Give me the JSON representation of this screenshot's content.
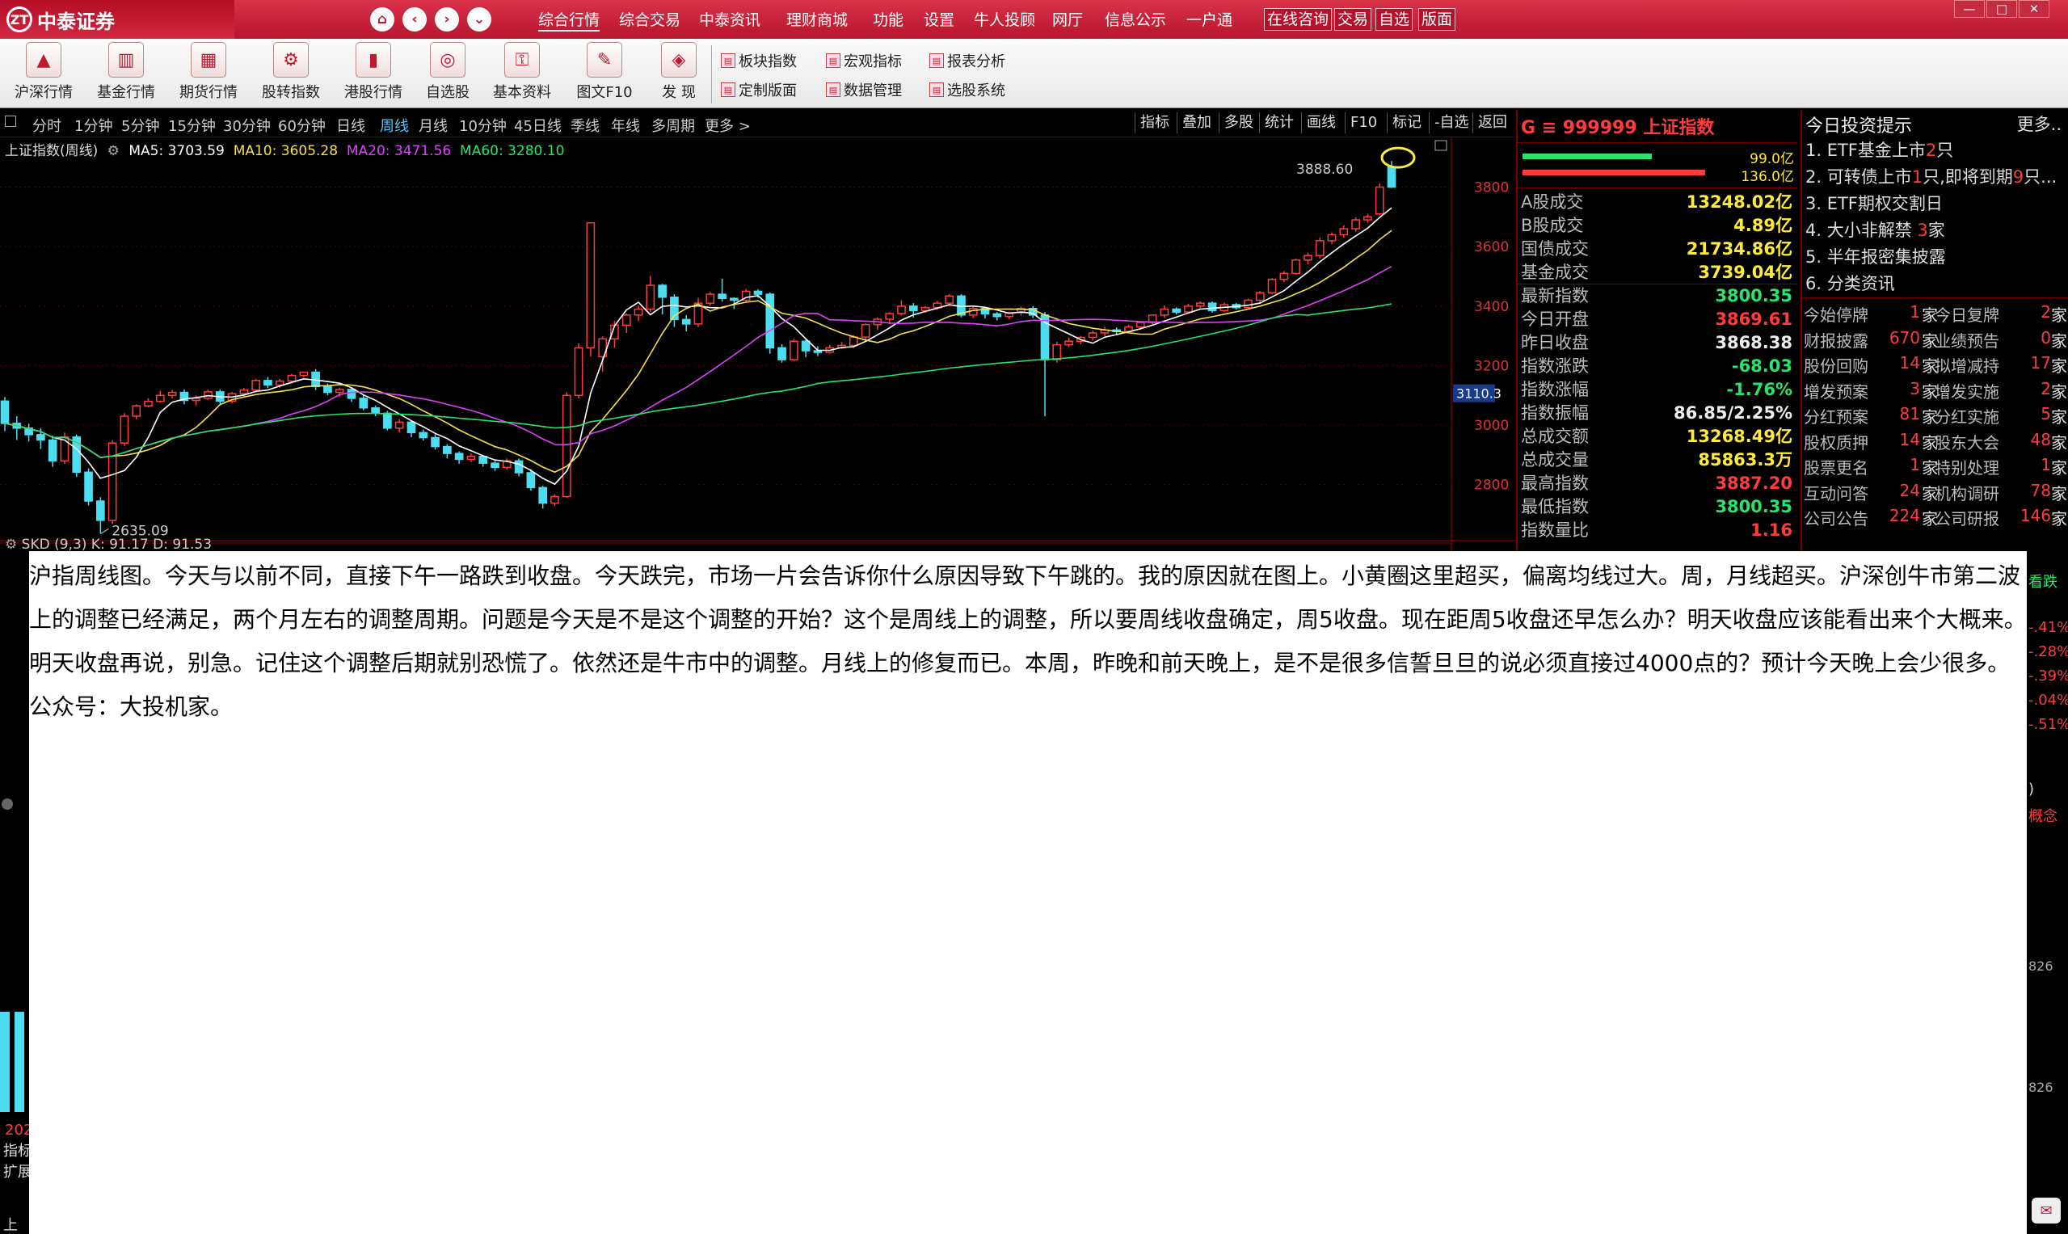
{
  "app": {
    "logo_text": "中泰证券",
    "logo_mark": "ZT",
    "nav_icons": [
      "home-icon",
      "back-icon",
      "forward-icon",
      "dropdown-icon"
    ],
    "menu": [
      "综合行情",
      "综合交易",
      "中泰资讯",
      "理财商城",
      "功能",
      "设置",
      "牛人投顾",
      "网厅",
      "信息公示",
      "一户通"
    ],
    "boxed_menu": [
      "在线咨询",
      "交易",
      "自选",
      "版面"
    ],
    "window_buttons": [
      "—",
      "□",
      "✕"
    ]
  },
  "toolbar": {
    "big_buttons": [
      "沪深行情",
      "基金行情",
      "期货行情",
      "股转指数",
      "港股行情",
      "自选股",
      "基本资料",
      "图文F10",
      "发 现"
    ],
    "small_buttons": [
      [
        "板块指数",
        "宏观指标",
        "报表分析"
      ],
      [
        "定制版面",
        "数据管理",
        "选股系统"
      ]
    ]
  },
  "periodbar": {
    "periods": [
      "分时",
      "1分钟",
      "5分钟",
      "15分钟",
      "30分钟",
      "60分钟",
      "日线",
      "周线",
      "月线",
      "10分钟",
      "45日线",
      "季线",
      "年线",
      "多周期",
      "更多 >"
    ],
    "active": "周线",
    "tools": [
      "指标",
      "叠加",
      "多股",
      "统计",
      "画线",
      "F10",
      "标记",
      "-自选",
      "返回"
    ]
  },
  "chart": {
    "title": "上证指数(周线)",
    "ma": [
      {
        "label": "MA5: 3703.59",
        "color": "#ffffff"
      },
      {
        "label": "MA10: 3605.28",
        "color": "#f4e04d"
      },
      {
        "label": "MA20: 3471.56",
        "color": "#e040fb"
      },
      {
        "label": "MA60: 3280.10",
        "color": "#29e36a"
      }
    ],
    "yticks": [
      "3800",
      "3600",
      "3400",
      "3200",
      "3000",
      "2800"
    ],
    "high_label": "3888.60",
    "low_label": "2635.09",
    "current_tag": "3110.3",
    "sub_indicator": "SKD (9,3) K: 91.17  D: 91.53"
  },
  "chart_data": {
    "type": "candlestick",
    "ylim": [
      2620,
      3940
    ],
    "candles": [
      [
        3081,
        3006,
        3095,
        2980
      ],
      [
        3006,
        2990,
        3030,
        2950
      ],
      [
        2990,
        2968,
        3005,
        2945
      ],
      [
        2968,
        2950,
        2990,
        2920
      ],
      [
        2950,
        2880,
        2965,
        2860
      ],
      [
        2880,
        2960,
        2975,
        2870
      ],
      [
        2960,
        2842,
        2968,
        2826
      ],
      [
        2842,
        2745,
        2855,
        2730
      ],
      [
        2745,
        2680,
        2758,
        2635
      ],
      [
        2680,
        2940,
        2950,
        2668
      ],
      [
        2940,
        3030,
        3040,
        2930
      ],
      [
        3030,
        3065,
        3070,
        3020
      ],
      [
        3065,
        3080,
        3090,
        3060
      ],
      [
        3080,
        3100,
        3115,
        3075
      ],
      [
        3100,
        3110,
        3118,
        3090
      ],
      [
        3110,
        3083,
        3120,
        3070
      ],
      [
        3083,
        3090,
        3100,
        3066
      ],
      [
        3090,
        3112,
        3120,
        3085
      ],
      [
        3112,
        3081,
        3120,
        3072
      ],
      [
        3081,
        3106,
        3112,
        3073
      ],
      [
        3106,
        3118,
        3125,
        3095
      ],
      [
        3118,
        3150,
        3155,
        3110
      ],
      [
        3150,
        3135,
        3162,
        3125
      ],
      [
        3135,
        3148,
        3155,
        3126
      ],
      [
        3148,
        3167,
        3172,
        3140
      ],
      [
        3167,
        3178,
        3180,
        3160
      ],
      [
        3178,
        3130,
        3188,
        3118
      ],
      [
        3130,
        3110,
        3140,
        3100
      ],
      [
        3110,
        3120,
        3126,
        3095
      ],
      [
        3120,
        3090,
        3128,
        3078
      ],
      [
        3090,
        3058,
        3100,
        3050
      ],
      [
        3058,
        3040,
        3066,
        3030
      ],
      [
        3040,
        2990,
        3048,
        2982
      ],
      [
        2990,
        3010,
        3020,
        2975
      ],
      [
        3010,
        2975,
        3016,
        2960
      ],
      [
        2975,
        2958,
        2985,
        2948
      ],
      [
        2958,
        2928,
        2970,
        2918
      ],
      [
        2928,
        2905,
        2936,
        2888
      ],
      [
        2905,
        2885,
        2912,
        2870
      ],
      [
        2885,
        2895,
        2905,
        2876
      ],
      [
        2895,
        2872,
        2900,
        2860
      ],
      [
        2872,
        2858,
        2880,
        2846
      ],
      [
        2858,
        2880,
        2888,
        2850
      ],
      [
        2880,
        2840,
        2888,
        2828
      ],
      [
        2840,
        2790,
        2852,
        2780
      ],
      [
        2790,
        2738,
        2796,
        2720
      ],
      [
        2738,
        2760,
        2768,
        2728
      ],
      [
        2760,
        3100,
        3110,
        2755
      ],
      [
        3100,
        3260,
        3275,
        3090
      ],
      [
        3260,
        3680,
        3680,
        3230
      ],
      [
        3230,
        3290,
        3298,
        3180
      ],
      [
        3290,
        3336,
        3350,
        3260
      ],
      [
        3336,
        3370,
        3375,
        3310
      ],
      [
        3370,
        3390,
        3402,
        3350
      ],
      [
        3390,
        3470,
        3502,
        3380
      ],
      [
        3470,
        3430,
        3475,
        3372
      ],
      [
        3430,
        3355,
        3440,
        3330
      ],
      [
        3355,
        3340,
        3370,
        3315
      ],
      [
        3340,
        3410,
        3428,
        3330
      ],
      [
        3410,
        3440,
        3447,
        3402
      ],
      [
        3440,
        3426,
        3492,
        3415
      ],
      [
        3426,
        3420,
        3430,
        3390
      ],
      [
        3420,
        3450,
        3458,
        3415
      ],
      [
        3450,
        3440,
        3456,
        3428
      ],
      [
        3440,
        3260,
        3446,
        3240
      ],
      [
        3260,
        3220,
        3272,
        3210
      ],
      [
        3220,
        3282,
        3290,
        3215
      ],
      [
        3282,
        3250,
        3290,
        3228
      ],
      [
        3250,
        3245,
        3265,
        3232
      ],
      [
        3245,
        3260,
        3270,
        3240
      ],
      [
        3260,
        3268,
        3280,
        3255
      ],
      [
        3268,
        3296,
        3302,
        3260
      ],
      [
        3296,
        3338,
        3342,
        3280
      ],
      [
        3338,
        3356,
        3362,
        3320
      ],
      [
        3356,
        3375,
        3380,
        3340
      ],
      [
        3375,
        3400,
        3420,
        3368
      ],
      [
        3400,
        3385,
        3410,
        3362
      ],
      [
        3385,
        3395,
        3400,
        3378
      ],
      [
        3395,
        3410,
        3418,
        3388
      ],
      [
        3410,
        3434,
        3440,
        3400
      ],
      [
        3434,
        3370,
        3440,
        3362
      ],
      [
        3370,
        3392,
        3400,
        3360
      ],
      [
        3392,
        3374,
        3398,
        3358
      ],
      [
        3374,
        3365,
        3380,
        3352
      ],
      [
        3365,
        3378,
        3382,
        3356
      ],
      [
        3378,
        3392,
        3398,
        3368
      ],
      [
        3392,
        3370,
        3400,
        3360
      ],
      [
        3370,
        3220,
        3380,
        3030
      ],
      [
        3220,
        3270,
        3280,
        3210
      ],
      [
        3270,
        3282,
        3295,
        3262
      ],
      [
        3282,
        3295,
        3300,
        3272
      ],
      [
        3295,
        3310,
        3318,
        3285
      ],
      [
        3310,
        3320,
        3330,
        3300
      ],
      [
        3320,
        3315,
        3328,
        3305
      ],
      [
        3315,
        3330,
        3338,
        3310
      ],
      [
        3330,
        3345,
        3350,
        3320
      ],
      [
        3345,
        3370,
        3372,
        3338
      ],
      [
        3370,
        3390,
        3402,
        3360
      ],
      [
        3390,
        3380,
        3396,
        3372
      ],
      [
        3380,
        3400,
        3408,
        3374
      ],
      [
        3400,
        3410,
        3416,
        3392
      ],
      [
        3410,
        3385,
        3416,
        3378
      ],
      [
        3385,
        3405,
        3412,
        3380
      ],
      [
        3405,
        3395,
        3410,
        3388
      ],
      [
        3395,
        3420,
        3425,
        3390
      ],
      [
        3420,
        3445,
        3450,
        3410
      ],
      [
        3445,
        3490,
        3494,
        3440
      ],
      [
        3490,
        3510,
        3518,
        3480
      ],
      [
        3510,
        3555,
        3560,
        3505
      ],
      [
        3555,
        3570,
        3580,
        3540
      ],
      [
        3570,
        3620,
        3630,
        3560
      ],
      [
        3620,
        3640,
        3648,
        3608
      ],
      [
        3640,
        3660,
        3672,
        3630
      ],
      [
        3660,
        3690,
        3698,
        3650
      ],
      [
        3690,
        3700,
        3710,
        3680
      ],
      [
        3710,
        3800,
        3812,
        3705
      ],
      [
        3868,
        3800,
        3888,
        3797
      ]
    ]
  },
  "quote": {
    "code_label": "G ≡ 999999 上证指数",
    "bar_vals": [
      "99.0亿",
      "136.0亿"
    ],
    "rows": [
      {
        "l": "A股成交",
        "v": "13248.02亿",
        "c": "yel"
      },
      {
        "l": "B股成交",
        "v": "4.89亿",
        "c": "yel"
      },
      {
        "l": "国债成交",
        "v": "21734.86亿",
        "c": "yel"
      },
      {
        "l": "基金成交",
        "v": "3739.04亿",
        "c": "yel"
      },
      {
        "l": "最新指数",
        "v": "3800.35",
        "c": "grn"
      },
      {
        "l": "今日开盘",
        "v": "3869.61",
        "c": "red"
      },
      {
        "l": "昨日收盘",
        "v": "3868.38",
        "c": "wht"
      },
      {
        "l": "指数涨跌",
        "v": "-68.03",
        "c": "grn"
      },
      {
        "l": "指数涨幅",
        "v": "-1.76%",
        "c": "grn"
      },
      {
        "l": "指数振幅",
        "v": "86.85/2.25%",
        "c": "wht"
      },
      {
        "l": "总成交额",
        "v": "13268.49亿",
        "c": "yel"
      },
      {
        "l": "总成交量",
        "v": "85863.3万",
        "c": "yel"
      },
      {
        "l": "最高指数",
        "v": "3887.20",
        "c": "red"
      },
      {
        "l": "最低指数",
        "v": "3800.35",
        "c": "grn"
      },
      {
        "l": "指数量比",
        "v": "1.16",
        "c": "red"
      }
    ]
  },
  "hints": {
    "title": "今日投资提示",
    "more": "更多..",
    "items": [
      [
        "1. ETF基金上市",
        "2",
        "只"
      ],
      [
        "2. 可转债上市",
        "1",
        "只,即将到期",
        "9",
        "只..."
      ],
      [
        "3. ETF期权交割日"
      ],
      [
        "4. 大小非解禁 ",
        "3",
        "家"
      ],
      [
        "5. 半年报密集披露"
      ],
      [
        "6. 分类资讯"
      ]
    ],
    "stats": [
      [
        "今始停牌",
        "1",
        "家",
        "今日复牌",
        "2",
        "家"
      ],
      [
        "财报披露",
        "670",
        "家",
        "业绩预告",
        "0",
        "家"
      ],
      [
        "股份回购",
        "14",
        "家",
        "拟增减持",
        "17",
        "家"
      ],
      [
        "增发预案",
        "3",
        "家",
        "增发实施",
        "2",
        "家"
      ],
      [
        "分红预案",
        "81",
        "家",
        "分红实施",
        "5",
        "家"
      ],
      [
        "股权质押",
        "14",
        "家",
        "股东大会",
        "48",
        "家"
      ],
      [
        "股票更名",
        "1",
        "家",
        "特别处理",
        "1",
        "家"
      ],
      [
        "互动问答",
        "24",
        "家",
        "机构调研",
        "78",
        "家"
      ],
      [
        "公司公告",
        "224",
        "家",
        "公司研报",
        "146",
        "家"
      ]
    ]
  },
  "edges": {
    "right_partial": [
      "看跌",
      "-.41%",
      "-.28%",
      "-.39%",
      "-.04%",
      "-.51%",
      ")",
      "概念",
      "826",
      "826"
    ],
    "left_partial": [
      "202",
      "指标",
      "扩展",
      "上"
    ]
  },
  "note": "沪指周线图。今天与以前不同，直接下午一路跌到收盘。今天跌完，市场一片会告诉你什么原因导致下午跳的。我的原因就在图上。小黄圈这里超买，偏离均线过大。周，月线超买。沪深创牛市第二波上的调整已经满足，两个月左右的调整周期。问题是今天是不是这个调整的开始？这个是周线上的调整，所以要周线收盘确定，周5收盘。现在距周5收盘还早怎么办？明天收盘应该能看出来个大概来。明天收盘再说，别急。记住这个调整后期就别恐慌了。依然还是牛市中的调整。月线上的修复而已。本周，昨晚和前天晚上，是不是很多信誓旦旦的说必须直接过4000点的？预计今天晚上会少很多。公众号：大投机家。"
}
